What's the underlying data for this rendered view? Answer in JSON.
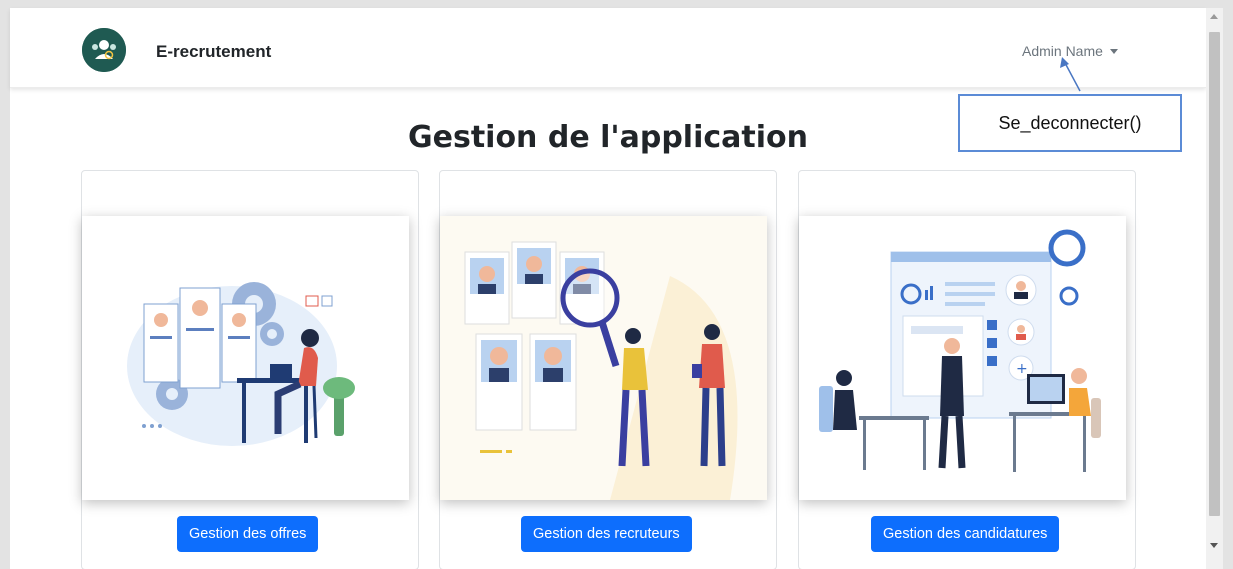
{
  "navbar": {
    "brand": "E-recrutement",
    "logo_icon": "team-recruitment-logo-icon",
    "user_menu": {
      "label": "Admin Name",
      "caret_icon": "caret-down-icon"
    }
  },
  "page_title": "Gestion de l'application",
  "annotation": {
    "label": "Se_deconnecter()"
  },
  "cards": [
    {
      "button": "Gestion des offres",
      "illustration": "job-offers-illustration"
    },
    {
      "button": "Gestion des recruteurs",
      "illustration": "recruiters-search-illustration"
    },
    {
      "button": "Gestion des candidatures",
      "illustration": "applications-office-illustration"
    }
  ],
  "colors": {
    "primary": "#0d6efd",
    "logo_bg": "#1f5a52",
    "callout_border": "#5b8bd6"
  }
}
